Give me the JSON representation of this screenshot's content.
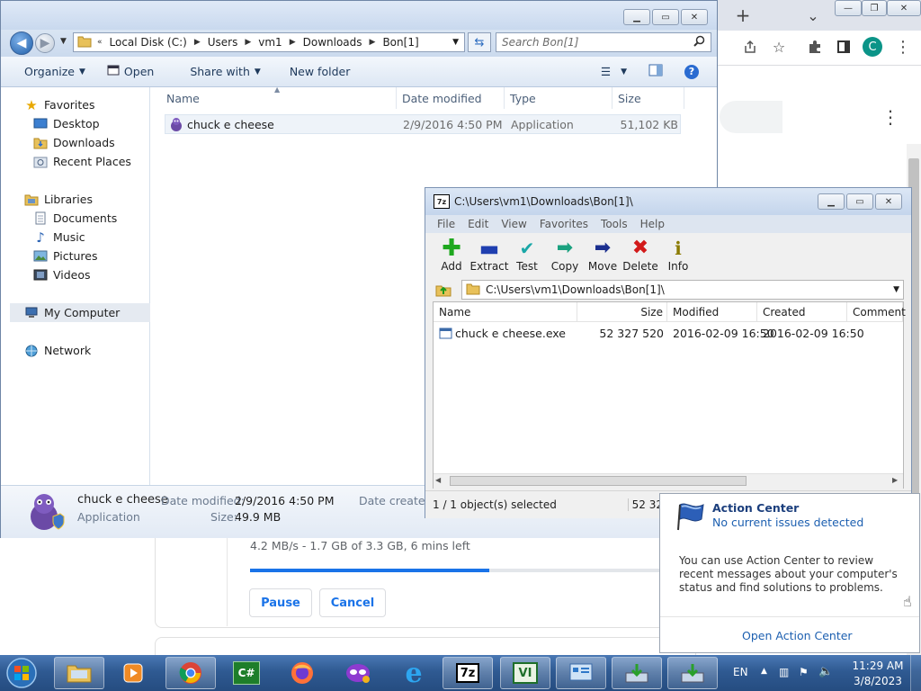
{
  "chrome": {
    "buttons": {
      "new_tab": "+",
      "tab_search": "⌄",
      "minimize": "—",
      "restore": "❐",
      "close": "✕"
    },
    "avatar_letter": "C",
    "download": {
      "status": "4.2 MB/s - 1.7 GB of 3.3 GB, 6 mins left",
      "progress": 0.565,
      "pause_label": "Pause",
      "cancel_label": "Cancel"
    },
    "accent": "#1a73e8"
  },
  "explorer": {
    "breadcrumb": [
      "Local Disk (C:)",
      "Users",
      "vm1",
      "Downloads",
      "Bon[1]"
    ],
    "breadcrumb_prefix": "«",
    "search_placeholder": "Search Bon[1]",
    "commands": {
      "organize": "Organize",
      "open": "Open",
      "share_with": "Share with",
      "new_folder": "New folder"
    },
    "nav": {
      "favorites": "Favorites",
      "desktop": "Desktop",
      "downloads": "Downloads",
      "recent_places": "Recent Places",
      "libraries": "Libraries",
      "documents": "Documents",
      "music": "Music",
      "pictures": "Pictures",
      "videos": "Videos",
      "my_computer": "My Computer",
      "network": "Network"
    },
    "columns": {
      "name": "Name",
      "date_modified": "Date modified",
      "type": "Type",
      "size": "Size"
    },
    "file": {
      "name": "chuck e cheese",
      "date_modified": "2/9/2016 4:50 PM",
      "type": "Application",
      "size": "51,102 KB"
    },
    "details": {
      "name": "chuck e cheese",
      "type": "Application",
      "date_modified_label": "Date modified:",
      "date_modified": "2/9/2016 4:50 PM",
      "size_label": "Size:",
      "size": "49.9 MB",
      "date_created_label": "Date created:"
    }
  },
  "sevenzip": {
    "title": "C:\\Users\\vm1\\Downloads\\Bon[1]\\",
    "menu": [
      "File",
      "Edit",
      "View",
      "Favorites",
      "Tools",
      "Help"
    ],
    "tools": {
      "add": "Add",
      "extract": "Extract",
      "test": "Test",
      "copy": "Copy",
      "move": "Move",
      "delete": "Delete",
      "info": "Info"
    },
    "path": "C:\\Users\\vm1\\Downloads\\Bon[1]\\",
    "columns": {
      "name": "Name",
      "size": "Size",
      "modified": "Modified",
      "created": "Created",
      "comment": "Comment"
    },
    "row": {
      "name": "chuck e cheese.exe",
      "size": "52 327 520",
      "modified": "2016-02-09 16:50",
      "created": "2016-02-09 16:50"
    },
    "status": "1 / 1 object(s) selected",
    "status_size": "52 32"
  },
  "action_center": {
    "title": "Action Center",
    "subtitle": "No current issues detected",
    "body": "You can use Action Center to review recent messages about your computer's status and find solutions to problems.",
    "link": "Open Action Center"
  },
  "taskbar": {
    "language": "EN",
    "time": "11:29 AM",
    "date": "3/8/2023",
    "sevenzip_label": "7z",
    "csharp_label": "C#",
    "vi_label": "VI"
  }
}
